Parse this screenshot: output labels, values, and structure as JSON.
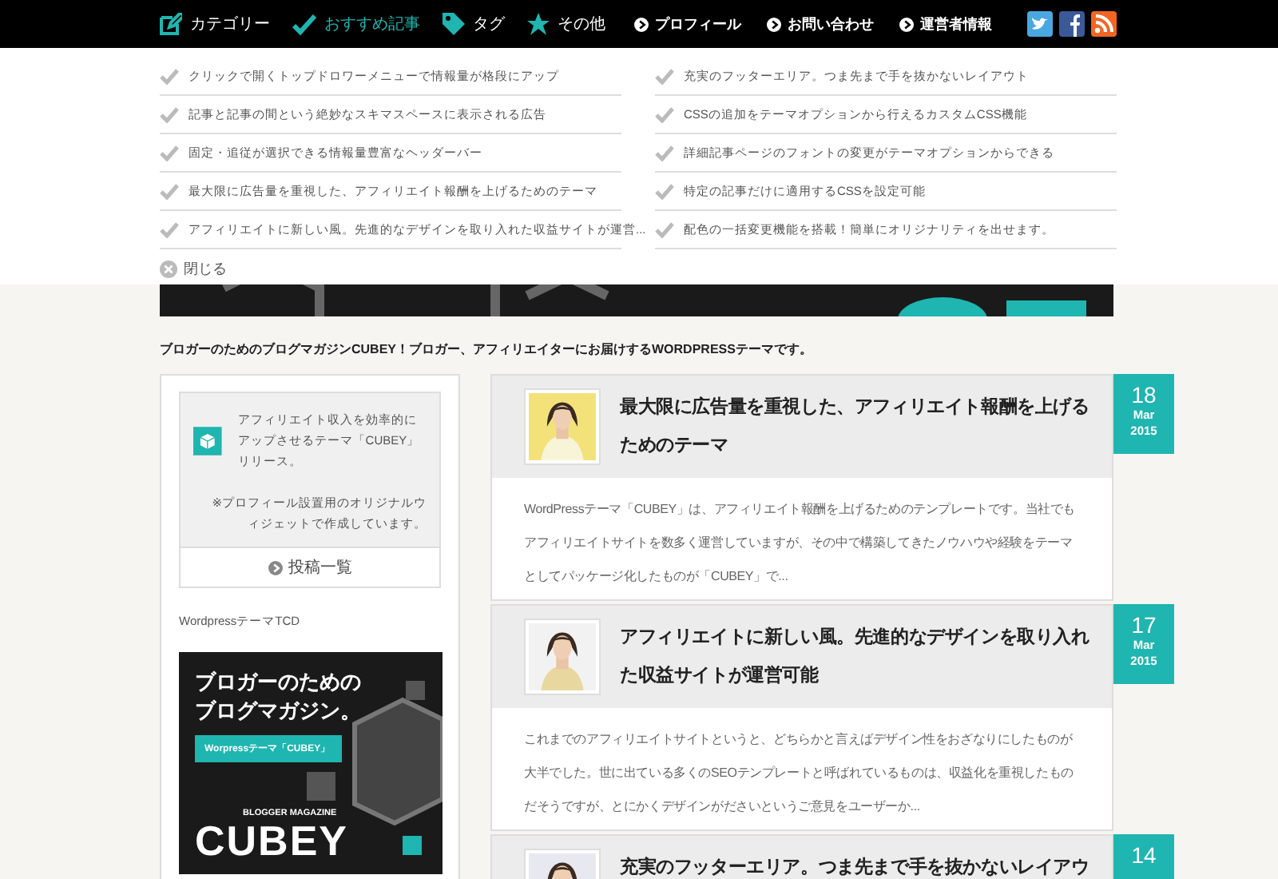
{
  "top_nav": {
    "menu": [
      {
        "label": "カテゴリー",
        "selected": false
      },
      {
        "label": "おすすめ記事",
        "selected": true
      },
      {
        "label": "タグ",
        "selected": false
      },
      {
        "label": "その他",
        "selected": false
      }
    ],
    "links": [
      "プロフィール",
      "お問い合わせ",
      "運営者情報"
    ]
  },
  "dropdown": {
    "columns": [
      [
        "クリックで開くトップドロワーメニューで情報量が格段にアップ",
        "記事と記事の間という絶妙なスキマスペースに表示される広告",
        "固定・追従が選択できる情報量豊富なヘッダーバー",
        "最大限に広告量を重視した、アフィリエイト報酬を上げるためのテーマ",
        "アフィリエイトに新しい風。先進的なデザインを取り入れた収益サイトが運営..."
      ],
      [
        "充実のフッターエリア。つま先まで手を抜かないレイアウト",
        "CSSの追加をテーマオプションから行えるカスタムCSS機能",
        "詳細記事ページのフォントの変更がテーマオプションからできる",
        "特定の記事だけに適用するCSSを設定可能",
        "配色の一括変更機能を搭載！簡単にオリジナリティを出せます。"
      ]
    ],
    "close_label": "閉じる"
  },
  "tagline": "ブロガーのためのブログマガジンCUBEY！ブロガー、アフィリエイターにお届けするWORDPRESSテーマです。",
  "sidebar": {
    "profile": {
      "text": "アフィリエイト収入を効率的にアップさせるテーマ「CUBEY」リリース。",
      "note": "※プロフィール設置用のオリジナルウィジェットで作成しています。",
      "button": "投稿一覧"
    },
    "widget_title": "WordpressテーマTCD",
    "banner": {
      "headline_1": "ブロガーのための",
      "headline_2": "ブログマガジン。",
      "button": "Worpressテーマ「CUBEY」",
      "subtitle": "BLOGGER MAGAZINE",
      "logo": "CUBEY"
    }
  },
  "posts": [
    {
      "title": "最大限に広告量を重視した、アフィリエイト報酬を上げるためのテーマ",
      "excerpt": "WordPressテーマ「CUBEY」は、アフィリエイト報酬を上げるためのテンプレートです。当社でもアフィリエイトサイトを数多く運営していますが、その中で構築してきたノウハウや経験をテーマとしてパッケージ化したものが「CUBEY」で...",
      "day": "18",
      "month": "Mar",
      "year": "2015"
    },
    {
      "title": "アフィリエイトに新しい風。先進的なデザインを取り入れた収益サイトが運営可能",
      "excerpt": "これまでのアフィリエイトサイトというと、どちらかと言えばデザイン性をおざなりにしたものが大半でした。世に出ている多くのSEOテンプレートと呼ばれているものは、収益化を重視したものだそうですが、とにかくデザインがださいというご意見をユーザーか...",
      "day": "17",
      "month": "Mar",
      "year": "2015"
    },
    {
      "title": "充実のフッターエリア。つま先まで手を抜かないレイアウ",
      "day": "14"
    }
  ]
}
